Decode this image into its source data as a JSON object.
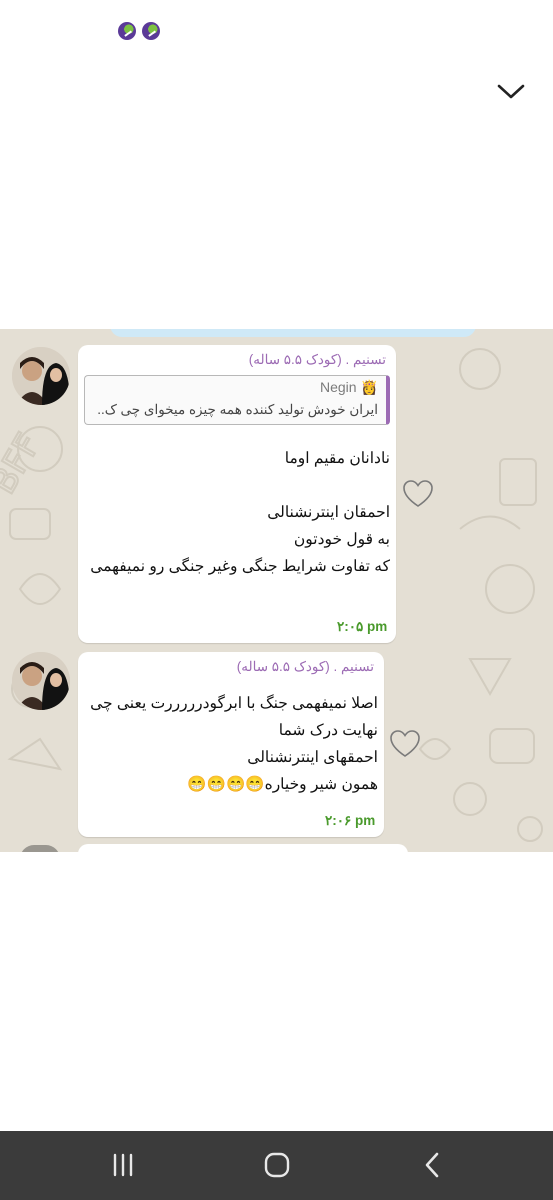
{
  "status_bar": {
    "icons": [
      "app-notification-icon",
      "app-notification-icon"
    ]
  },
  "collapse_icon": "chevron-down-icon",
  "colors": {
    "sender_name": "#9c6bb4",
    "timestamp": "#4a9a2c",
    "chat_background": "#e4dfd4",
    "bubble": "#ffffff",
    "nav_bar": "#3b3b3b"
  },
  "messages": [
    {
      "sender": "تسنیم . (کودک ۵.۵ ساله)",
      "reply": {
        "name": "Negin",
        "name_emoji": "👸",
        "text": "ایران خودش تولید کننده همه چیزه میخوای چی ک.."
      },
      "lines": [
        "نادانان مقیم اوما",
        "",
        "احمقان اینترنشنالی",
        "به قول خودتون",
        "که تفاوت شرایط جنگی وغیر جنگی رو نمیفهمی"
      ],
      "time": "۲:۰۵ pm"
    },
    {
      "sender": "تسنیم . (کودک ۵.۵ ساله)",
      "lines": [
        "اصلا نمیفهمی جنگ با ابرگودرررررت یعنی چی",
        "نهایت درک شما",
        "احمقهای اینترنشنالی",
        "همون شیر وخیاره😁😁😁😁"
      ],
      "time": "۲:۰۶ pm"
    }
  ],
  "nav": {
    "recents_icon": "recent-apps-icon",
    "home_icon": "home-icon",
    "back_icon": "back-icon"
  }
}
